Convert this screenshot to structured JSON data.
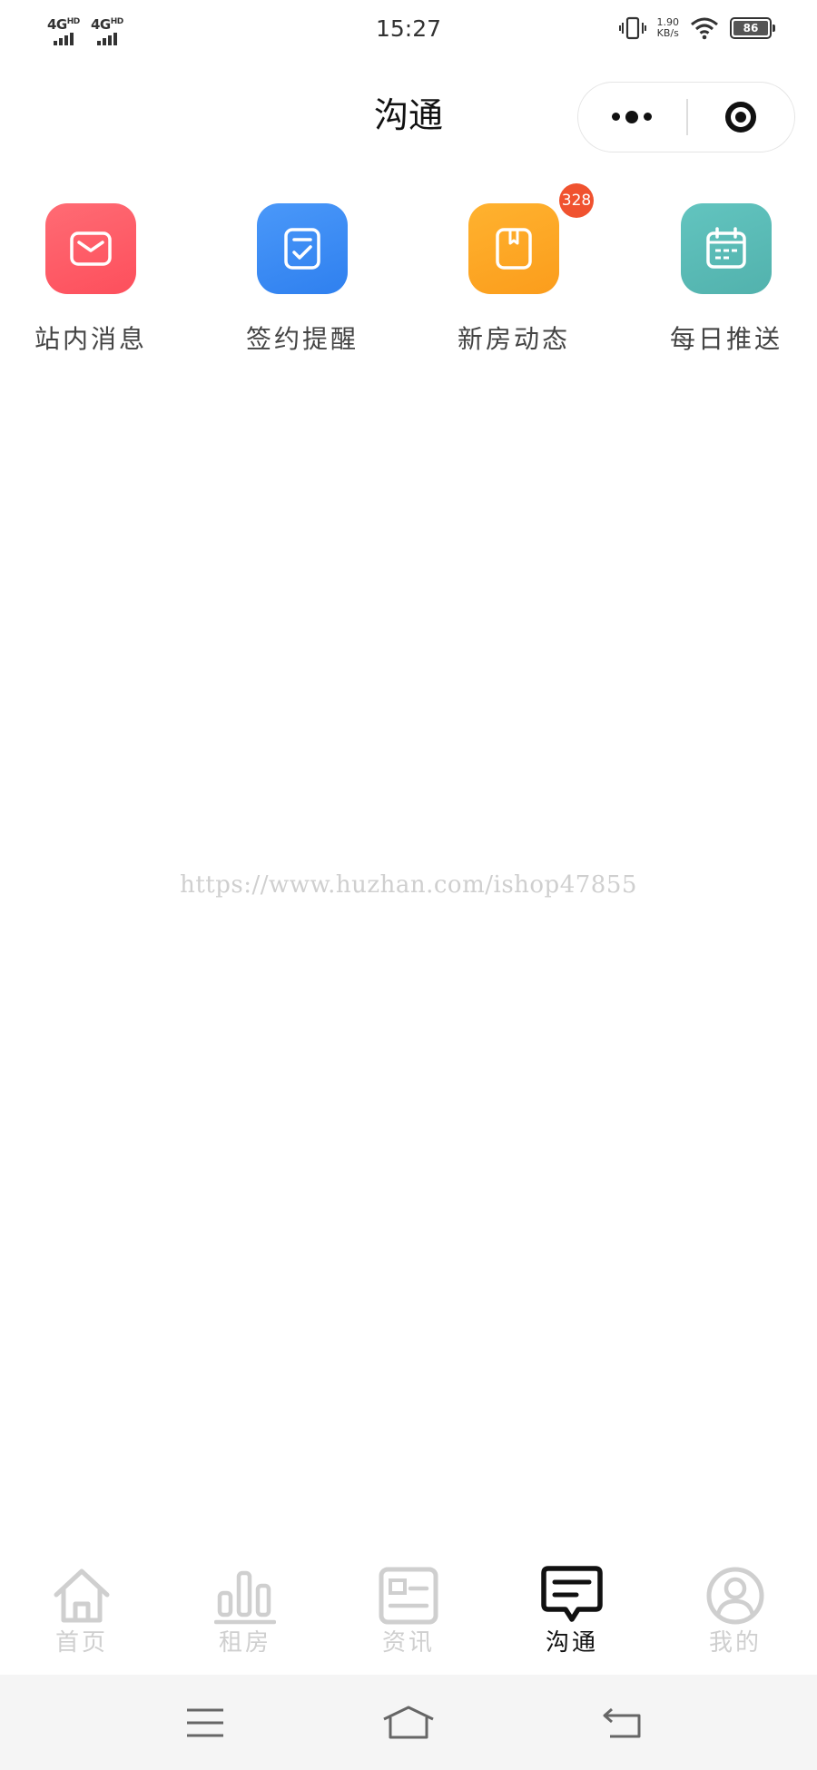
{
  "status_bar": {
    "sim1": "4G",
    "sim1_hd": "HD",
    "sim2": "4G",
    "sim2_hd": "HD",
    "time": "15:27",
    "speed_value": "1.90",
    "speed_unit": "KB/s",
    "battery": "86",
    "icons": [
      "vibrate-icon",
      "wifi-icon",
      "battery-icon"
    ]
  },
  "header": {
    "title": "沟通",
    "capsule": {
      "more_icon": "more-dots-icon",
      "close_icon": "target-close-icon"
    }
  },
  "entries": [
    {
      "label": "站内消息",
      "icon": "mail-icon",
      "color": "#ff5a66"
    },
    {
      "label": "签约提醒",
      "icon": "checklist-icon",
      "color": "#3b8cf5"
    },
    {
      "label": "新房动态",
      "icon": "bookmark-icon",
      "color": "#fda524",
      "badge": "328"
    },
    {
      "label": "每日推送",
      "icon": "calendar-icon",
      "color": "#5bbdb8"
    }
  ],
  "watermark": "https://www.huzhan.com/ishop47855",
  "tabbar": {
    "active_index": 3,
    "items": [
      {
        "label": "首页",
        "icon": "home-icon"
      },
      {
        "label": "租房",
        "icon": "bar-chart-icon"
      },
      {
        "label": "资讯",
        "icon": "news-icon"
      },
      {
        "label": "沟通",
        "icon": "message-icon"
      },
      {
        "label": "我的",
        "icon": "user-icon"
      }
    ]
  },
  "colors": {
    "active_tab": "#111111",
    "inactive_tab": "#cfcfcf",
    "badge": "#f0522f"
  },
  "system_nav": {
    "icons": [
      "menu-icon",
      "home-outline-icon",
      "back-icon"
    ]
  }
}
